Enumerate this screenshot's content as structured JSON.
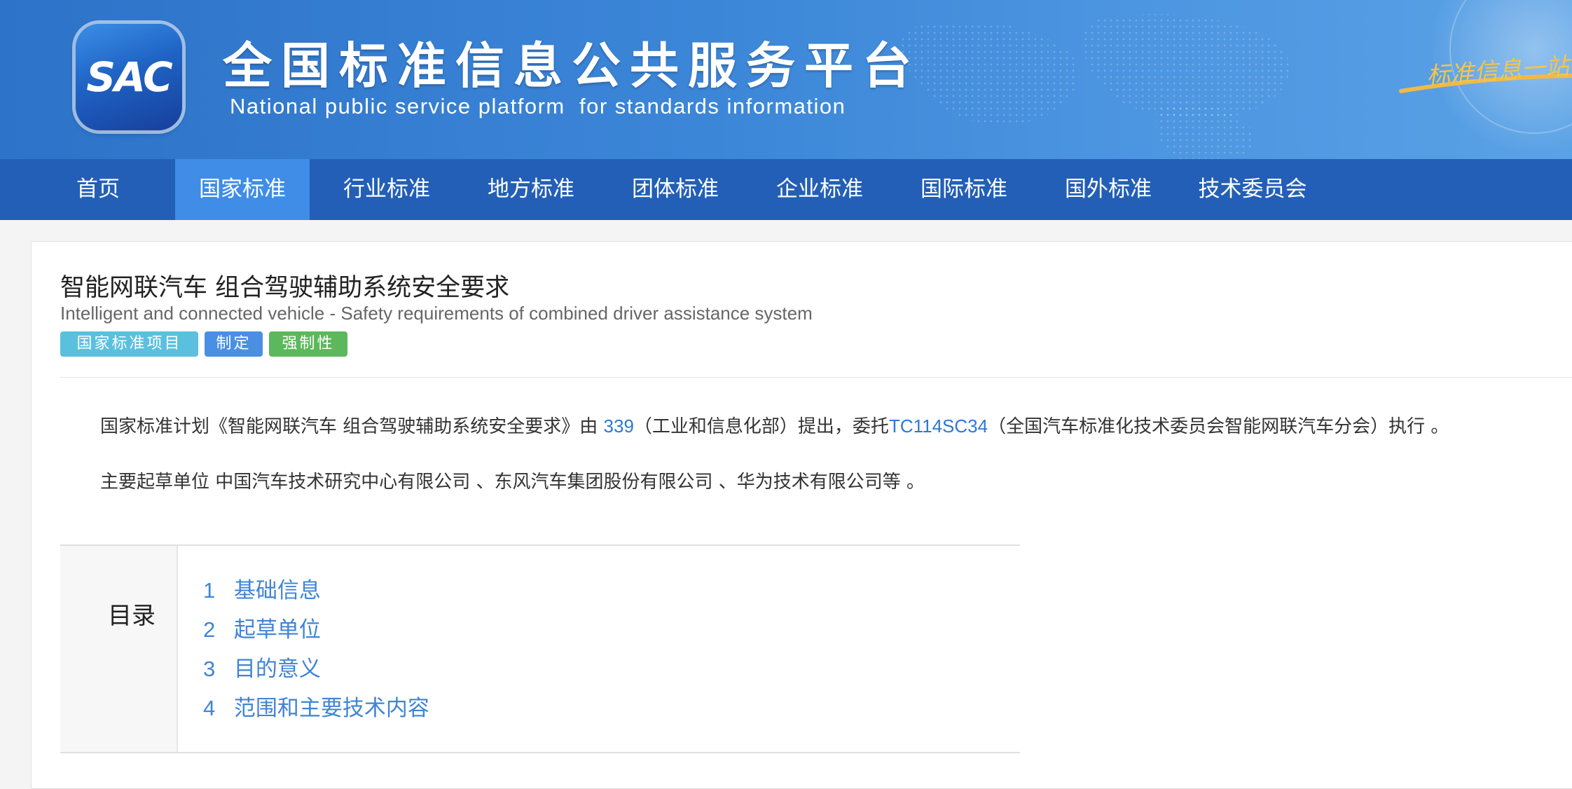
{
  "header": {
    "logo_text": "SAC",
    "site_title_cn": "全国标准信息公共服务平台",
    "site_title_en": "National public service platform  for standards information",
    "slogan": "标准信息一站"
  },
  "nav": {
    "items": [
      {
        "label": "首页",
        "active": false
      },
      {
        "label": "国家标准",
        "active": true
      },
      {
        "label": "行业标准",
        "active": false
      },
      {
        "label": "地方标准",
        "active": false
      },
      {
        "label": "团体标准",
        "active": false
      },
      {
        "label": "企业标准",
        "active": false
      },
      {
        "label": "国际标准",
        "active": false
      },
      {
        "label": "国外标准",
        "active": false
      },
      {
        "label": "技术委员会",
        "active": false
      }
    ]
  },
  "document": {
    "title_cn": "智能网联汽车 组合驾驶辅助系统安全要求",
    "title_en": "Intelligent and connected vehicle - Safety requirements of combined driver assistance system",
    "badges": {
      "project": "国家标准项目",
      "type": "制定",
      "nature": "强制性"
    },
    "plan": {
      "prefix": "国家标准计划《智能网联汽车 组合驾驶辅助系统安全要求》由 ",
      "proposer_code": "339",
      "middle": "（工业和信息化部）提出，委托",
      "committee_code": "TC114SC34",
      "suffix": "（全国汽车标准化技术委员会智能网联汽车分会）执行 。"
    },
    "drafters": "主要起草单位 中国汽车技术研究中心有限公司 、东风汽车集团股份有限公司 、华为技术有限公司等 。"
  },
  "toc": {
    "label": "目录",
    "items": [
      {
        "num": "1",
        "label": "基础信息"
      },
      {
        "num": "2",
        "label": "起草单位"
      },
      {
        "num": "3",
        "label": "目的意义"
      },
      {
        "num": "4",
        "label": "范围和主要技术内容"
      }
    ]
  }
}
